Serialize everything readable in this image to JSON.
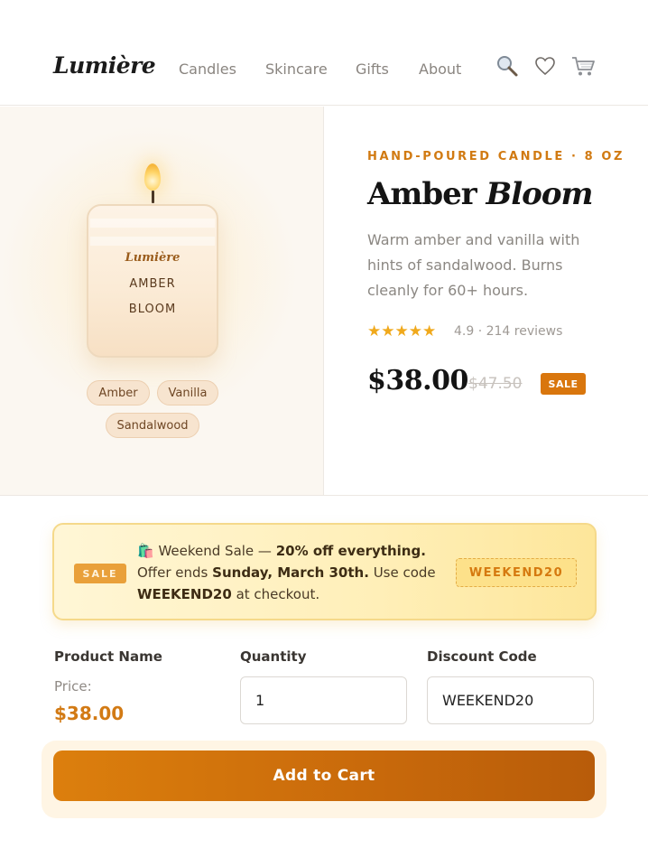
{
  "header": {
    "logo": "Lumière",
    "nav": [
      "Candles",
      "Skincare",
      "Gifts",
      "About"
    ],
    "icons": [
      "search-icon",
      "heart-icon",
      "cart-icon"
    ]
  },
  "product_visual": {
    "candle_brand": "Lumière",
    "candle_line1": "AMBER",
    "candle_line2": "BLOOM",
    "notes": [
      "Amber",
      "Vanilla",
      "Sandalwood"
    ]
  },
  "product": {
    "eyebrow": "HAND-POURED CANDLE · 8 OZ",
    "title_main": "Amber",
    "title_italic": "Bloom",
    "description": "Warm amber and vanilla with hints of sandalwood. Burns cleanly for 60+ hours.",
    "stars": "★★★★★",
    "rating_text": "4.9 · 214 reviews",
    "price": "$38.00",
    "old_price": "$47.50",
    "sale_badge": "SALE"
  },
  "promo": {
    "badge": "SALE",
    "emoji": "🛍️",
    "line_intro": "Weekend Sale — ",
    "line_bold": "20% off everything.",
    "ends_prefix": "Offer ends ",
    "ends_date": "Sunday, March 30th.",
    "code_prefix": " Use code ",
    "code_inline": "WEEKEND20",
    "code_suffix": " at checkout.",
    "code": "WEEKEND20"
  },
  "form": {
    "product_name_label": "Product Name",
    "price_label": "Price:",
    "price_value": "$38.00",
    "quantity_label": "Quantity",
    "quantity_value": "1",
    "discount_label": "Discount Code",
    "discount_value": "WEEKEND20"
  },
  "cta": {
    "add_to_cart": "Add to Cart"
  },
  "colors": {
    "accent": "#d9760d",
    "star": "#f0a91c",
    "promo_bg": "#fff0bd"
  }
}
